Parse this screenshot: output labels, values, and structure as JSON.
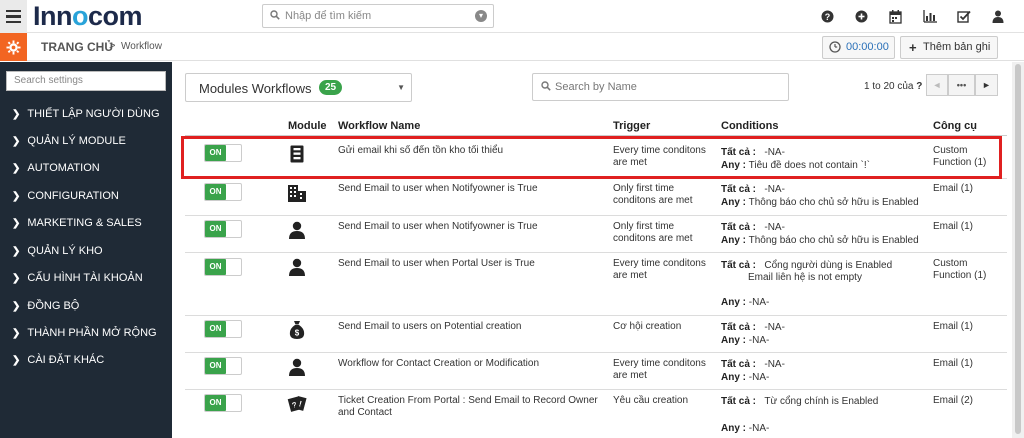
{
  "header": {
    "brand_prefix": "Inn",
    "brand_o": "o",
    "brand_suffix": "com",
    "search_placeholder": "Nhập để tìm kiếm",
    "icons": [
      "help-icon",
      "add-circle-icon",
      "calendar-icon",
      "bar-chart-icon",
      "checkbox-icon",
      "user-icon"
    ]
  },
  "breadcrumb": {
    "home": "TRANG CHỦ",
    "separator": ">",
    "current": "Workflow",
    "timer": "00:00:00",
    "add_record": "Thêm bản ghi"
  },
  "sidebar": {
    "search_placeholder": "Search settings",
    "items": [
      {
        "label": "THIẾT LẬP NGƯỜI DÙNG"
      },
      {
        "label": "QUẢN LÝ MODULE"
      },
      {
        "label": "AUTOMATION"
      },
      {
        "label": "CONFIGURATION"
      },
      {
        "label": "MARKETING & SALES"
      },
      {
        "label": "QUẢN LÝ KHO"
      },
      {
        "label": "CẤU HÌNH TÀI KHOẢN"
      },
      {
        "label": "ĐỒNG BỘ"
      },
      {
        "label": "THÀNH PHẦN MỞ RỘNG"
      },
      {
        "label": "CÀI ĐẶT KHÁC"
      }
    ]
  },
  "toolbar": {
    "module_select": "Modules Workflows",
    "module_count": "25",
    "name_search_placeholder": "Search by Name",
    "paging_text": "1 to 20  của",
    "paging_q": "?",
    "more_btn": "•••",
    "next_btn": "►",
    "prev_btn": "◄"
  },
  "colors": {
    "accent_orange": "#f26522",
    "sidebar_bg": "#1f2a36",
    "toggle_green": "#3aa34b",
    "highlight_red": "#e02020",
    "link_blue": "#2a70b8"
  },
  "table": {
    "headers": {
      "module": "Module",
      "name": "Workflow Name",
      "trigger": "Trigger",
      "conditions": "Conditions",
      "tools": "Công cụ"
    },
    "rows": [
      {
        "toggle": "ON",
        "module_icon": "book-icon",
        "name": "Gửi email khi số đến tồn kho tối thiểu",
        "trigger": "Every time conditons are met",
        "cond_all_label": "Tất cả :",
        "cond_all_value": "-NA-",
        "cond_any_label": "Any :",
        "cond_any_value": "Tiêu đề does not contain `!`",
        "tools": "Custom Function (1)"
      },
      {
        "toggle": "ON",
        "module_icon": "building-icon",
        "name": "Send Email to user when Notifyowner is True",
        "trigger": "Only first time conditons are met",
        "cond_all_label": "Tất cả :",
        "cond_all_value": "-NA-",
        "cond_any_label": "Any :",
        "cond_any_value": "Thông báo cho chủ sở hữu is Enabled",
        "tools": "Email (1)"
      },
      {
        "toggle": "ON",
        "module_icon": "person-icon",
        "name": "Send Email to user when Notifyowner is True",
        "trigger": "Only first time conditons are met",
        "cond_all_label": "Tất cả :",
        "cond_all_value": "-NA-",
        "cond_any_label": "Any :",
        "cond_any_value": "Thông báo cho chủ sở hữu is Enabled",
        "tools": "Email (1)"
      },
      {
        "toggle": "ON",
        "module_icon": "person-icon",
        "name": "Send Email to user when Portal User is True",
        "trigger": "Every time conditons are met",
        "cond_all_label": "Tất cả :",
        "cond_all_value": "Cổng người dùng is Enabled",
        "cond_all_value2": "Email liên hệ is not empty",
        "cond_any_label": "Any :",
        "cond_any_value": "-NA-",
        "tools": "Custom Function (1)"
      },
      {
        "toggle": "ON",
        "module_icon": "money-bag-icon",
        "name": "Send Email to users on Potential creation",
        "trigger": "Cơ hội creation",
        "cond_all_label": "Tất cả :",
        "cond_all_value": "-NA-",
        "cond_any_label": "Any :",
        "cond_any_value": "-NA-",
        "tools": "Email (1)"
      },
      {
        "toggle": "ON",
        "module_icon": "person-icon",
        "name": "Workflow for Contact Creation or Modification",
        "trigger": "Every time conditons are met",
        "cond_all_label": "Tất cả :",
        "cond_all_value": "-NA-",
        "cond_any_label": "Any :",
        "cond_any_value": "-NA-",
        "tools": "Email (1)"
      },
      {
        "toggle": "ON",
        "module_icon": "ticket-icon",
        "name": "Ticket Creation From Portal : Send Email to Record Owner and Contact",
        "trigger": "Yêu cầu creation",
        "cond_all_label": "Tất cả :",
        "cond_all_value": "Từ cổng chính is Enabled",
        "cond_any_label": "Any :",
        "cond_any_value": "-NA-",
        "tools": "Email (2)"
      }
    ]
  }
}
